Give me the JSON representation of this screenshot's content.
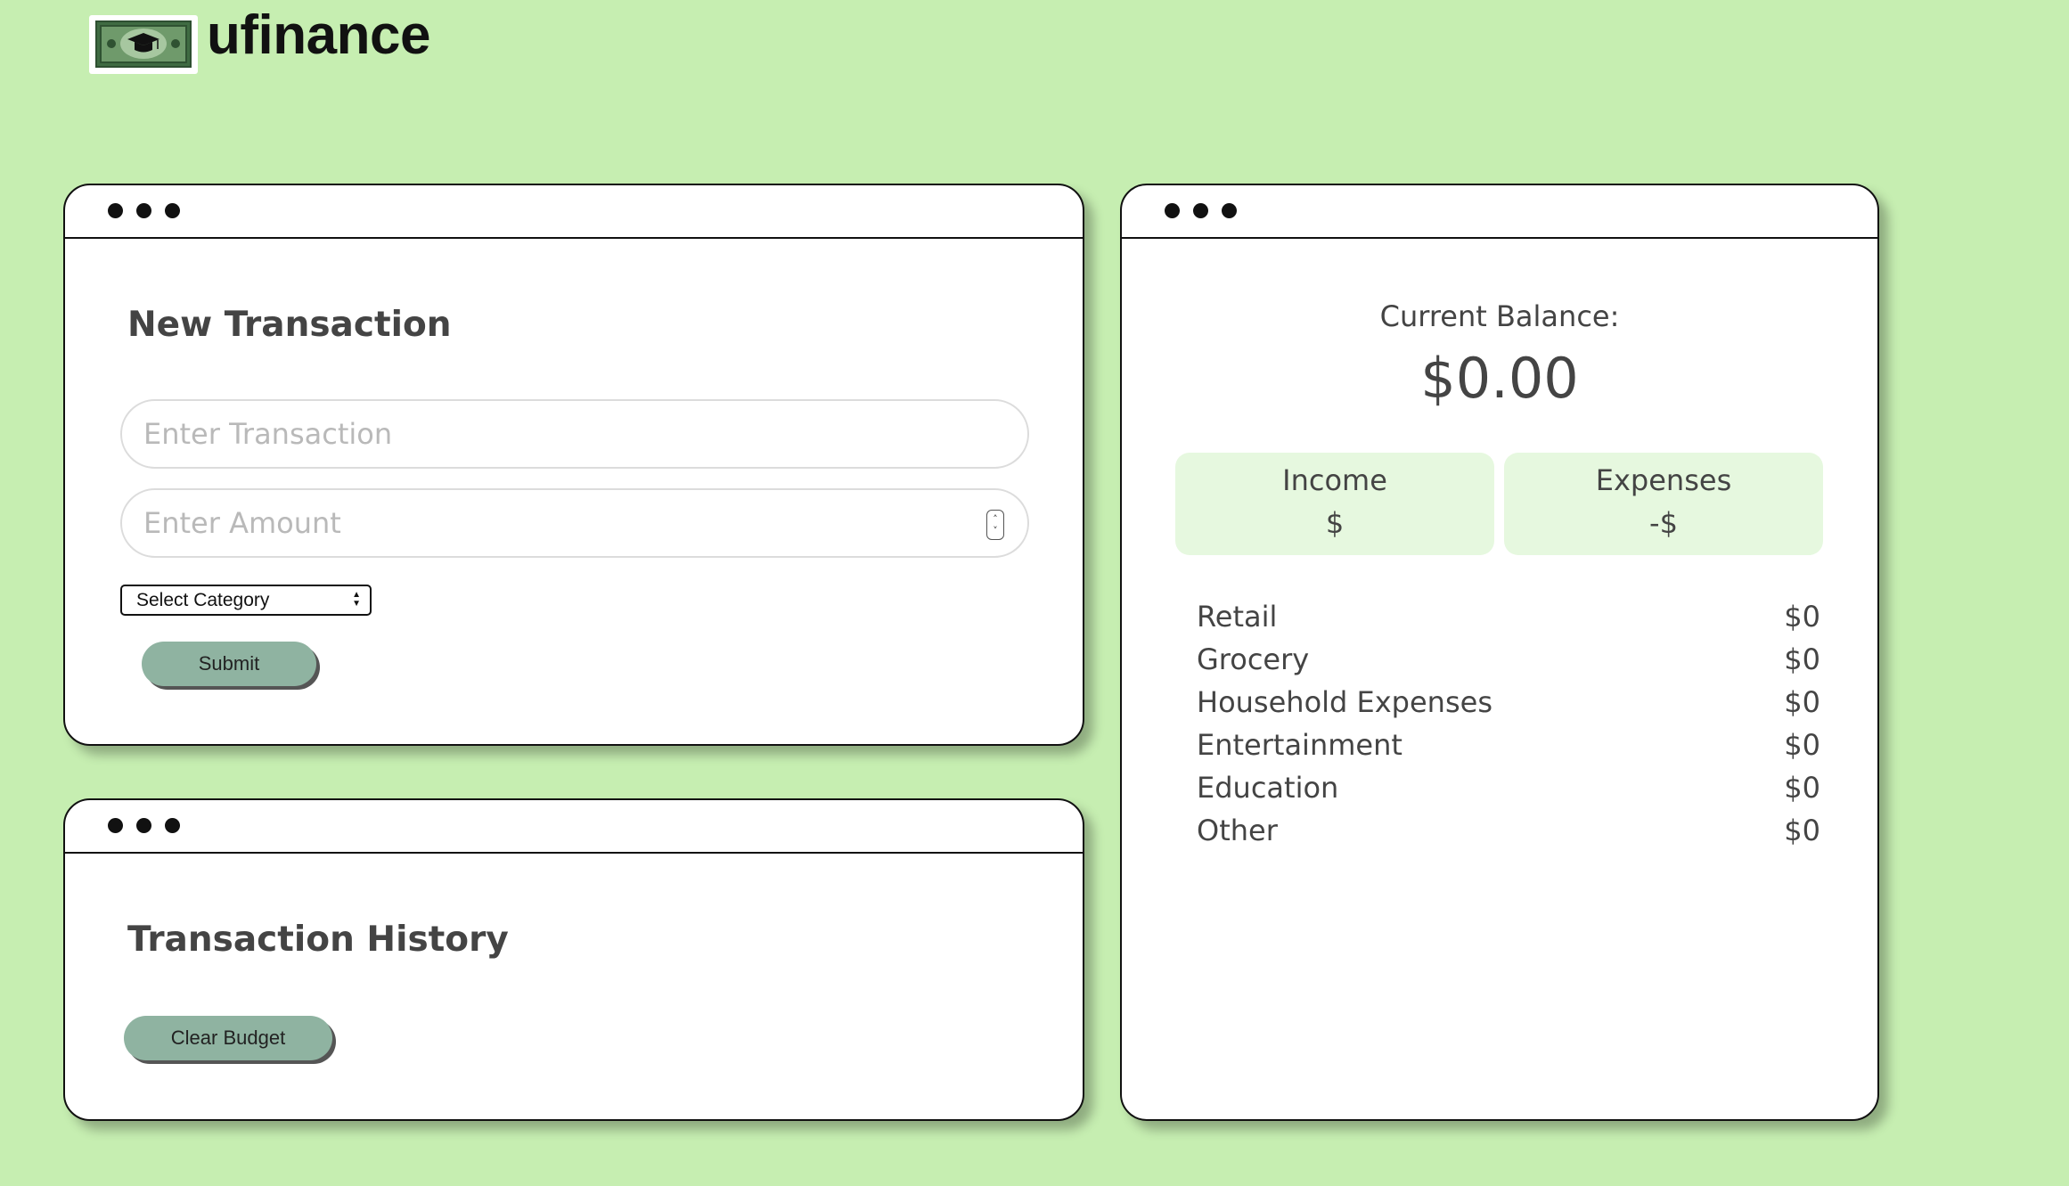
{
  "app": {
    "name": "ufinance",
    "logo_icon": "money-graduation-cap-icon"
  },
  "colors": {
    "background": "#c6eeb1",
    "button": "#8fb3a1",
    "stat_box": "#e6f8df"
  },
  "new_transaction": {
    "title": "New Transaction",
    "transaction_placeholder": "Enter Transaction",
    "amount_placeholder": "Enter Amount",
    "category_selected": "Select Category",
    "submit_label": "Submit"
  },
  "history": {
    "title": "Transaction History",
    "clear_label": "Clear Budget"
  },
  "balance": {
    "label": "Current Balance:",
    "value": "$0.00",
    "income_label": "Income",
    "income_value": "$",
    "expenses_label": "Expenses",
    "expenses_value": "-$",
    "categories": [
      {
        "name": "Retail",
        "amount": "$0"
      },
      {
        "name": "Grocery",
        "amount": "$0"
      },
      {
        "name": "Household Expenses",
        "amount": "$0"
      },
      {
        "name": "Entertainment",
        "amount": "$0"
      },
      {
        "name": "Education",
        "amount": "$0"
      },
      {
        "name": "Other",
        "amount": "$0"
      }
    ]
  }
}
